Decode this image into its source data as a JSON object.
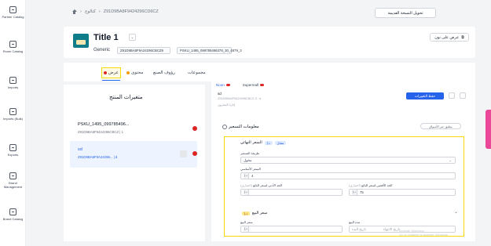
{
  "nav": {
    "items": [
      {
        "label": "Partner Catalog"
      },
      {
        "label": "Room Catalog"
      },
      {
        "label": "Imports"
      },
      {
        "label": "Imports (Bulk)"
      },
      {
        "label": "Exports"
      },
      {
        "label": "Brand Management"
      },
      {
        "label": "Brand Catalog"
      }
    ]
  },
  "breadcrumb": {
    "section": "كتالوج",
    "id": "Z91D9BA8F9424296CD6CZ"
  },
  "header": {
    "old_version_label": "تحويل النسخة القديمة"
  },
  "product": {
    "title": "Title 1",
    "type": "Generic",
    "chip1": "Z91D9BA8F9A24296CBCZ9",
    "chip2": "PSKU_1495_099785496378_30_4879_3",
    "preview_label": "عرض على نون"
  },
  "tabs": [
    {
      "label": "عرض",
      "dot_color": "#dc2626"
    },
    {
      "label": "محتوى",
      "dot_color": "#f59e0b"
    },
    {
      "label": "رؤوف الصنع",
      "dot_color": ""
    },
    {
      "label": "مجموعات",
      "dot_color": ""
    }
  ],
  "variations": {
    "title": "متغيرات المنتج",
    "items": [
      {
        "name": "PSKU_1495_099785496...",
        "sub": "Z91D9BA8F9424296CBCZ | 1",
        "selected": false
      },
      {
        "name": "sd",
        "sub": "Z91D9BA8F9A24296... | d",
        "selected": true
      }
    ]
  },
  "offer": {
    "subtabs": [
      {
        "label": "Noon"
      },
      {
        "label": "Supermall"
      }
    ],
    "code": "sd",
    "meta": "Z91D9BA8F9A24296CBCZ-3 · d",
    "meta2": "إدارة المخزون",
    "save_label": "حفظ التغييرات",
    "pricing_title": "معلومات التسعير",
    "pricing_hint": "مطبق عبر الأسواق",
    "final_price_label": "السعر النهائي",
    "currency_tag": "د.إ",
    "badge": "معدل",
    "pricing_method_label": "طريقة التسعير",
    "pricing_method_value": "مخول",
    "base_price_label": "السعر الأساسي",
    "base_price_value": "4",
    "max_label": "الحد الأقصى لسعر البائع",
    "max_value": "75",
    "min_label": "الحد الأدنى لسعر البائع",
    "min_value": "",
    "optional": "(اختياري)",
    "sale_title": "سعر البيع",
    "sale_price_label": "سعر البيع",
    "sale_period_label": "مدة البيع",
    "start_date_placeholder": "تاريخ البدء",
    "end_date_placeholder": "تاريخ الانتهاء"
  },
  "watermark": {
    "line1": "Activate Windows",
    "line2": "Go to Settings to activate Windows."
  }
}
